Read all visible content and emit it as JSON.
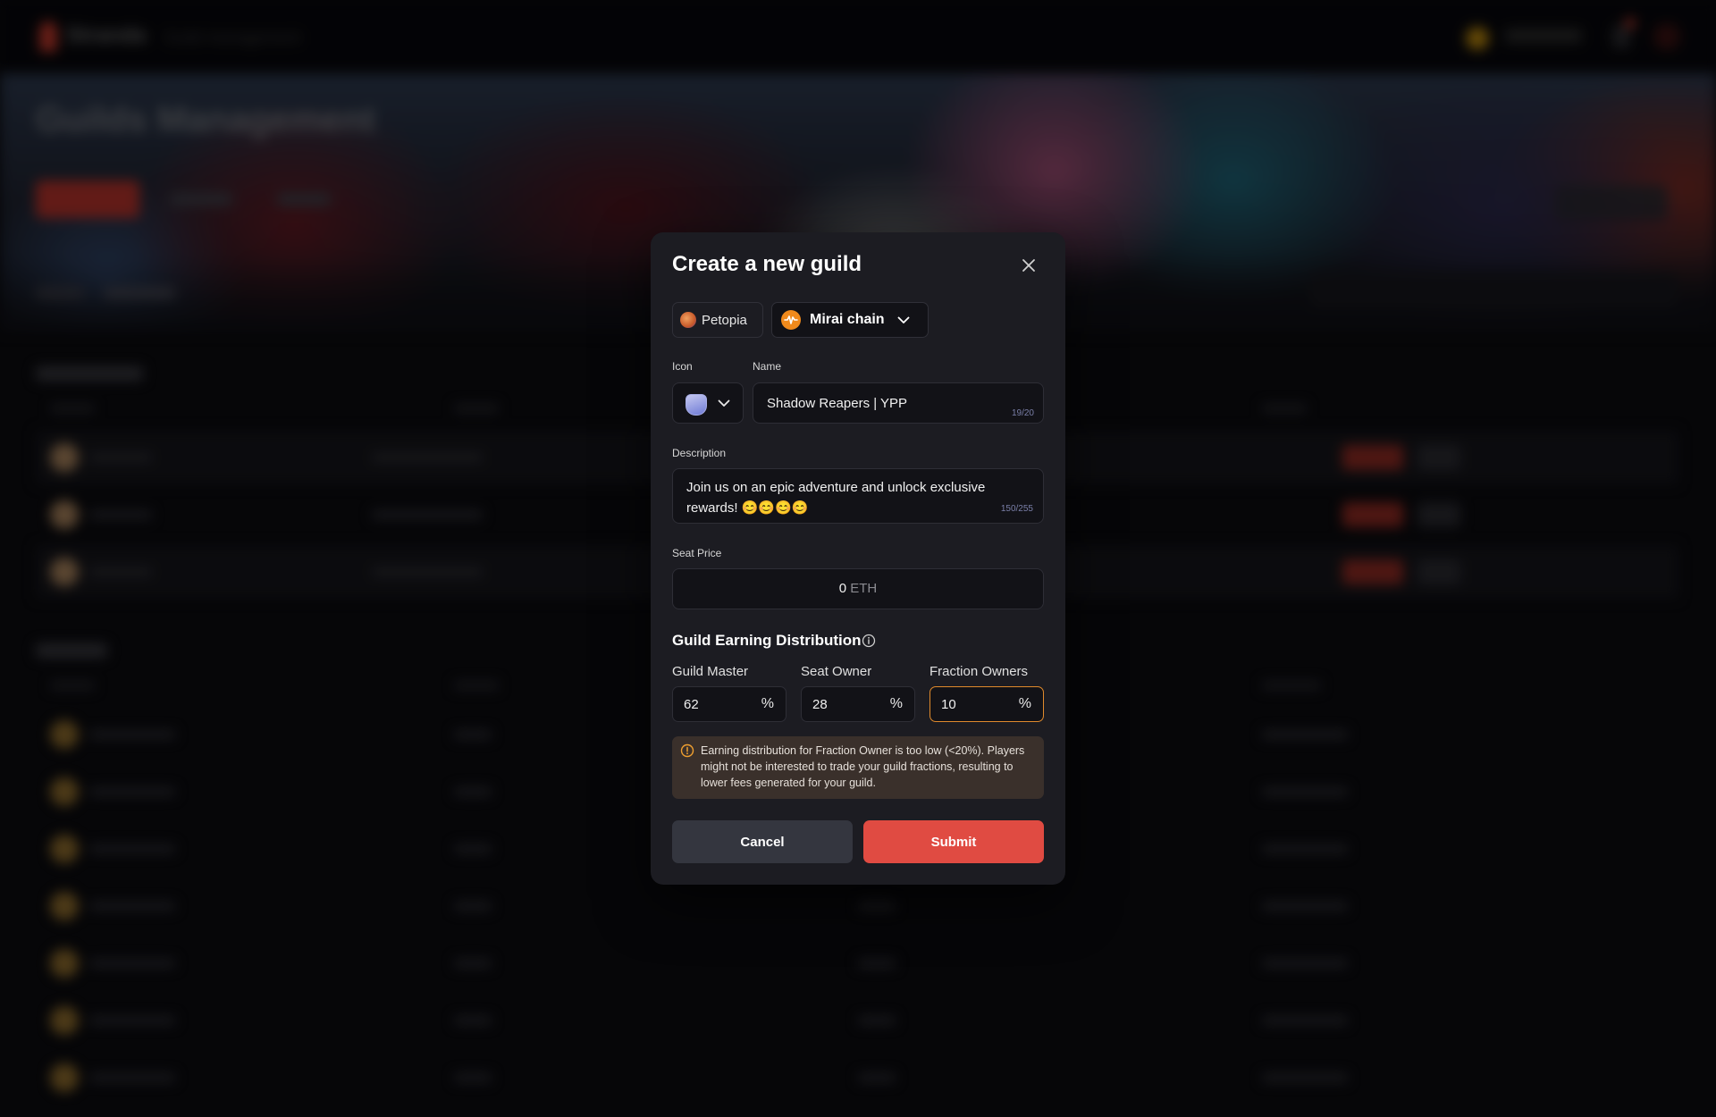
{
  "background": {
    "app_name": "Stranda",
    "breadcrumb": "Guild management",
    "hero_title": "Guilds Management"
  },
  "modal": {
    "title": "Create a new guild",
    "close_icon": "close-icon",
    "game": {
      "label": "Petopia",
      "icon": "petopia-game-icon"
    },
    "chain": {
      "label": "Mirai chain",
      "icon": "mirai-chain-icon"
    },
    "icon_field": {
      "label": "Icon",
      "selected_icon": "guild-shield-icon"
    },
    "name_field": {
      "label": "Name",
      "value": "Shadow Reapers | YPP",
      "counter": "19/20"
    },
    "description_field": {
      "label": "Description",
      "value": "Join us on an epic adventure and unlock exclusive rewards! 😊😊😊😊",
      "counter": "150/255"
    },
    "seat_price": {
      "label": "Seat Price",
      "value": "0",
      "unit": "ETH"
    },
    "distribution": {
      "title": "Guild Earning Distribution",
      "fields": [
        {
          "label": "Guild Master",
          "value": "62",
          "unit": "%"
        },
        {
          "label": "Seat Owner",
          "value": "28",
          "unit": "%"
        },
        {
          "label": "Fraction Owners",
          "value": "10",
          "unit": "%"
        }
      ]
    },
    "warning": "Earning distribution for Fraction Owner is too low (<20%). Players might not be interested to trade your guild fractions, resulting to lower fees generated for your guild.",
    "cancel_label": "Cancel",
    "submit_label": "Submit",
    "colors": {
      "accent": "#e04b42",
      "warning_border": "#e08a2c",
      "modal_bg": "#1c1c22"
    }
  }
}
